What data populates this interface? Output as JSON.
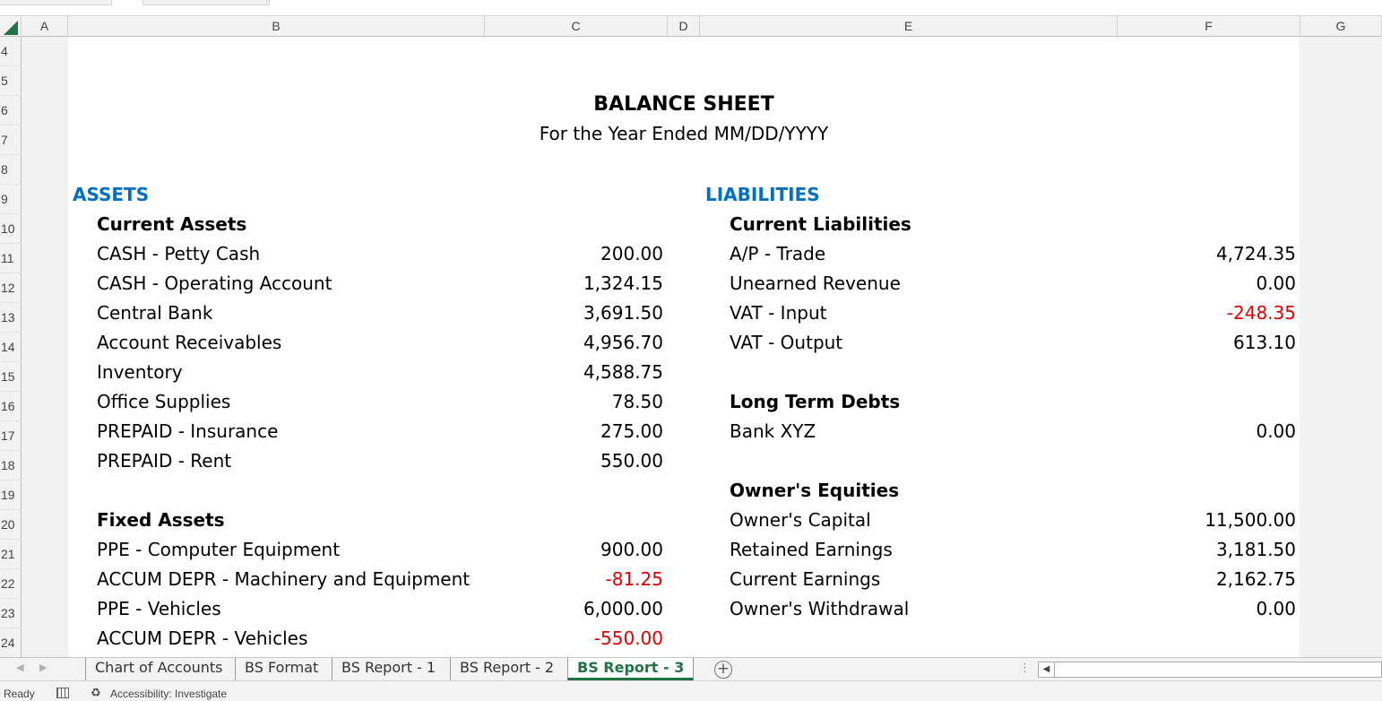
{
  "columns": [
    "A",
    "B",
    "C",
    "D",
    "E",
    "F",
    "G"
  ],
  "rows": [
    "4",
    "5",
    "6",
    "7",
    "8",
    "9",
    "10",
    "11",
    "12",
    "13",
    "14",
    "15",
    "16",
    "17",
    "18",
    "19",
    "20",
    "21",
    "22",
    "23",
    "24"
  ],
  "report": {
    "title": "BALANCE SHEET",
    "subtitle": "For the Year Ended MM/DD/YYYY"
  },
  "assets": {
    "heading": "ASSETS",
    "current_heading": "Current Assets",
    "current": [
      {
        "label": "CASH - Petty Cash",
        "value": "200.00",
        "negative": false
      },
      {
        "label": "CASH - Operating Account",
        "value": "1,324.15",
        "negative": false
      },
      {
        "label": "Central Bank",
        "value": "3,691.50",
        "negative": false
      },
      {
        "label": "Account Receivables",
        "value": "4,956.70",
        "negative": false
      },
      {
        "label": "Inventory",
        "value": "4,588.75",
        "negative": false
      },
      {
        "label": "Office Supplies",
        "value": "78.50",
        "negative": false
      },
      {
        "label": "PREPAID - Insurance",
        "value": "275.00",
        "negative": false
      },
      {
        "label": "PREPAID - Rent",
        "value": "550.00",
        "negative": false
      }
    ],
    "fixed_heading": "Fixed Assets",
    "fixed": [
      {
        "label": "PPE - Computer Equipment",
        "value": "900.00",
        "negative": false
      },
      {
        "label": "ACCUM DEPR - Machinery and Equipment",
        "value": "-81.25",
        "negative": true
      },
      {
        "label": "PPE - Vehicles",
        "value": "6,000.00",
        "negative": false
      },
      {
        "label": "ACCUM DEPR - Vehicles",
        "value": "-550.00",
        "negative": true
      }
    ]
  },
  "liabilities": {
    "heading": "LIABILITIES",
    "current_heading": "Current Liabilities",
    "current": [
      {
        "label": "A/P - Trade",
        "value": "4,724.35",
        "negative": false
      },
      {
        "label": "Unearned Revenue",
        "value": "0.00",
        "negative": false
      },
      {
        "label": "VAT - Input",
        "value": "-248.35",
        "negative": true
      },
      {
        "label": "VAT - Output",
        "value": "613.10",
        "negative": false
      }
    ],
    "longterm_heading": "Long Term Debts",
    "longterm": [
      {
        "label": "Bank XYZ",
        "value": "0.00",
        "negative": false
      }
    ],
    "equity_heading": "Owner's Equities",
    "equity": [
      {
        "label": "Owner's Capital",
        "value": "11,500.00",
        "negative": false
      },
      {
        "label": "Retained Earnings",
        "value": "3,181.50",
        "negative": false
      },
      {
        "label": "Current Earnings",
        "value": "2,162.75",
        "negative": false
      },
      {
        "label": "Owner's Withdrawal",
        "value": "0.00",
        "negative": false
      }
    ]
  },
  "sheet_tabs": [
    {
      "label": "Chart of Accounts",
      "active": false
    },
    {
      "label": "BS Format",
      "active": false
    },
    {
      "label": "BS Report - 1",
      "active": false
    },
    {
      "label": "BS Report - 2",
      "active": false
    },
    {
      "label": "BS Report - 3",
      "active": true
    }
  ],
  "add_sheet_icon": "plus-circle",
  "status": {
    "ready": "Ready",
    "accessibility": "Accessibility: Investigate"
  },
  "colors": {
    "accent_green": "#217346",
    "heading_blue": "#0070c0",
    "negative_red": "#e00000"
  }
}
